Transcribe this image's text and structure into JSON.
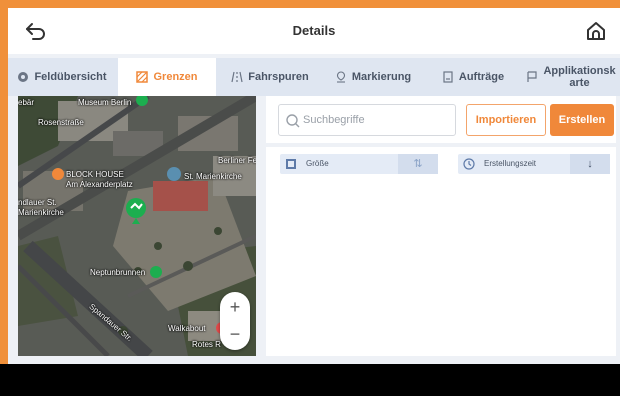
{
  "header": {
    "title": "Details"
  },
  "tabs": [
    {
      "label": "Feldübersicht",
      "icon": "field-overview-icon",
      "active": false
    },
    {
      "label": "Grenzen",
      "icon": "boundary-icon",
      "active": true
    },
    {
      "label": "Fahrspuren",
      "icon": "lane-icon",
      "active": false
    },
    {
      "label": "Markierung",
      "icon": "marker-icon",
      "active": false
    },
    {
      "label": "Aufträge",
      "icon": "tasks-icon",
      "active": false
    },
    {
      "label_line1": "Applikationsk",
      "label_line2": "arte",
      "icon": "application-map-icon",
      "active": false
    }
  ],
  "map": {
    "labels": {
      "museum": "Museum Berlin",
      "street_top": "Rosenstraße",
      "top_left": "ebär",
      "block_house": "BLOCK HOUSE",
      "alexanderplatz": "Am Alexanderplatz",
      "berliner_fe": "Berliner Fe",
      "marienkirche": "St. Marienkirche",
      "st_left": "ndlauer St.",
      "marienkirche_left": "Marienkirche",
      "neptunbrunnen": "Neptunbrunnen",
      "spandauer": "Spandauer Str.",
      "walkabout": "Walkabout",
      "rotes": "Rotes R"
    },
    "zoom_in": "+",
    "zoom_out": "−"
  },
  "toolbar": {
    "search_placeholder": "Suchbegriffe",
    "import_label": "Importieren",
    "create_label": "Erstellen"
  },
  "sort": {
    "size_label": "Größe",
    "size_icon": "size-icon",
    "size_sort_symbol": "⇅",
    "time_label": "Erstellungszeit",
    "time_icon": "clock-icon",
    "time_sort_symbol": "↓"
  },
  "colors": {
    "accent": "#f0883a",
    "tab_bar": "#dfe6f1",
    "sort_bar": "#e4ebf6",
    "map_pin": "#1cae4f"
  }
}
